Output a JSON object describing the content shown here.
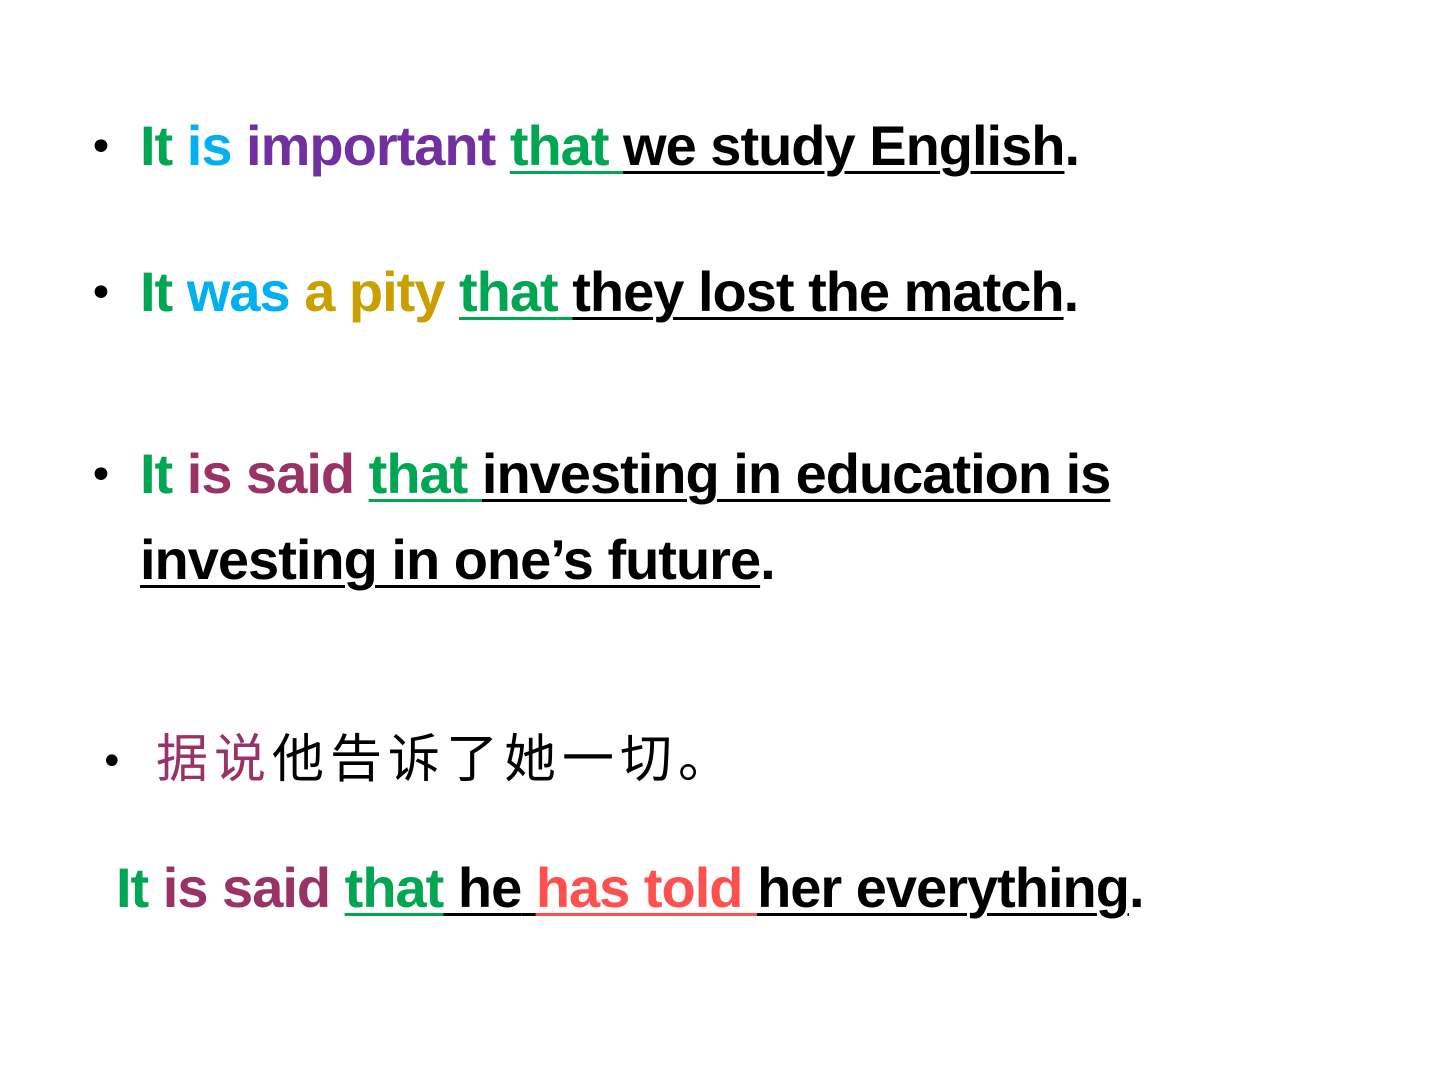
{
  "colors": {
    "green": "#00a651",
    "blue": "#00b0f0",
    "purple": "#7030a0",
    "gold": "#c9a000",
    "plum": "#993366",
    "black": "#000000",
    "red": "#ff5050"
  },
  "bullet_char": "•",
  "s1": {
    "w1": "It",
    "w2": "is",
    "w3": "important",
    "that": "that",
    "clause": "we study English",
    "end": "."
  },
  "s2": {
    "w1": "It",
    "w2": "was",
    "w3": "a pity",
    "that": "that",
    "clause": "they lost the match",
    "end": "."
  },
  "s3": {
    "w1": "It",
    "w2": "is said",
    "that": "that",
    "clause1": "investing in education is",
    "clause2": "investing in one’s future",
    "end": "."
  },
  "s4": {
    "cn_a": "据说",
    "cn_b": "他告诉了她一切。"
  },
  "s5": {
    "w1": "It",
    "w2": "is said",
    "that": "that",
    "he": "he",
    "verb": "has told",
    "rest": "her everything",
    "end": "."
  }
}
